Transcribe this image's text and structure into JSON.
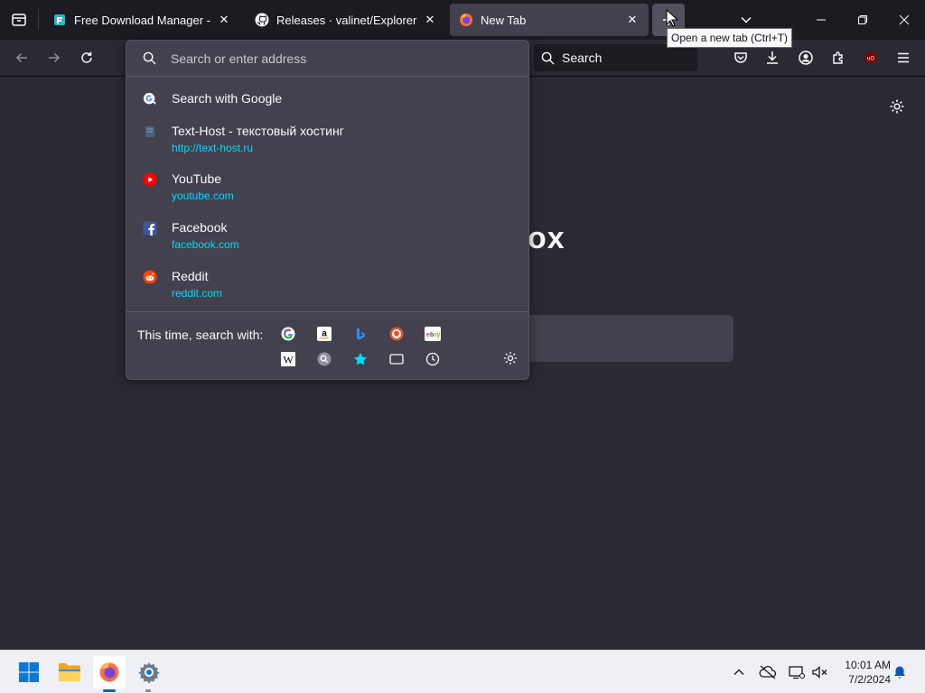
{
  "tabs": [
    {
      "title": "Free Download Manager - dow",
      "icon": "fdm-icon",
      "active": false
    },
    {
      "title": "Releases · valinet/ExplorerPatch",
      "icon": "github-icon",
      "active": false
    },
    {
      "title": "New Tab",
      "icon": "firefox-icon",
      "active": true
    }
  ],
  "tooltip": "Open a new tab (Ctrl+T)",
  "navbar": {
    "search_label": "Search"
  },
  "urlbar": {
    "placeholder": "Search or enter address",
    "results": [
      {
        "title": "Search with Google",
        "url": "",
        "icon": "google-search-icon"
      },
      {
        "title": "Text-Host - текстовый хостинг",
        "url": "http://text-host.ru",
        "icon": "page-icon"
      },
      {
        "title": "YouTube",
        "url": "youtube.com",
        "icon": "youtube-icon"
      },
      {
        "title": "Facebook",
        "url": "facebook.com",
        "icon": "facebook-icon"
      },
      {
        "title": "Reddit",
        "url": "reddit.com",
        "icon": "reddit-icon"
      }
    ],
    "oneoff_label": "This time, search with:",
    "oneoffs_row1": [
      "google-icon",
      "amazon-icon",
      "bing-icon",
      "duckduckgo-icon",
      "ebay-icon"
    ],
    "oneoffs_row2": [
      "wikipedia-icon",
      "search-engine-icon",
      "bookmarks-star-icon",
      "tabs-icon",
      "history-icon"
    ]
  },
  "page": {
    "brand_fragment": "ox"
  },
  "taskbar": {
    "time": "10:01 AM",
    "date": "7/2/2024"
  },
  "colors": {
    "accent": "#00ddff",
    "tab_bg": "#1c1b22",
    "toolbar_bg": "#2b2a33",
    "panel_bg": "#42414d"
  }
}
